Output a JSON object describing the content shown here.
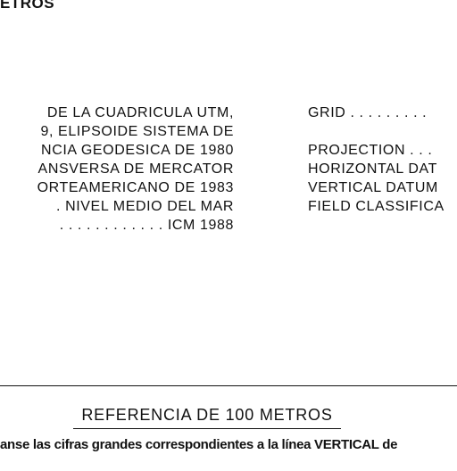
{
  "header": {
    "title": "ETROS"
  },
  "left_column": {
    "lines": [
      "DE LA CUADRICULA UTM,",
      "9, ELIPSOIDE SISTEMA DE",
      "NCIA GEODESICA DE 1980",
      "ANSVERSA DE MERCATOR",
      "ORTEAMERICANO DE 1983",
      ". NIVEL MEDIO DEL MAR",
      ". . . . . . . . . . . . ICM 1988"
    ]
  },
  "right_column": {
    "grid": "GRID . . . . . . . . .",
    "projection": "PROJECTION . . .",
    "horizontal_datum": "HORIZONTAL DAT",
    "vertical_datum": "VERTICAL DATUM",
    "field_classification": "FIELD CLASSIFICA"
  },
  "reference": {
    "title": "REFERENCIA DE 100 METROS",
    "note": "anse las cifras grandes correspondientes a la línea VERTICAL de"
  }
}
